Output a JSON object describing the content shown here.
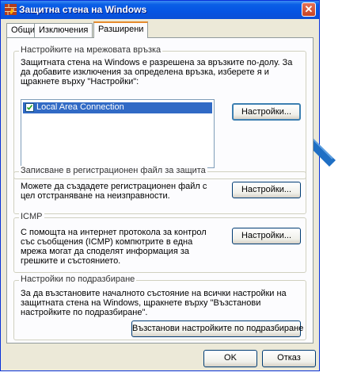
{
  "window": {
    "title": "Защитна стена на Windows",
    "close_glyph": "✕"
  },
  "tabs": [
    {
      "label": "Общи"
    },
    {
      "label": "Изключения"
    },
    {
      "label": "Разширени"
    }
  ],
  "active_tab": "Разширени",
  "network": {
    "legend": "Настройките на мрежовата връзка",
    "description": "Защитната стена на Windows е разрешена за връзките по-долу. За да добавите изключения за определена връзка, изберете я и щракнете върху \"Настройки\":",
    "connections": [
      {
        "label": "Local Area Connection",
        "checked": true,
        "selected": true
      }
    ],
    "settings_button": "Настройки..."
  },
  "logging": {
    "legend": "Записване в регистрационен файл за защита",
    "description": "Можете да създадете регистрационен файл с цел отстраняване на неизправности.",
    "settings_button": "Настройки..."
  },
  "icmp": {
    "legend": "ICMP",
    "description": "С помощта на интернет протокола за контрол със съобщения (ICMP) компютрите в една мрежа могат да споделят информация за грешките и състоянието.",
    "settings_button": "Настройки..."
  },
  "defaults": {
    "legend": "Настройки по подразбиране",
    "description": "За да възстановите началното състояние на всички настройки на защитната стена на Windows, щракнете върху \"Възстанови настройките по подразбиране\".",
    "restore_button": "Възстанови настройките по подразбиране"
  },
  "footer": {
    "ok_button": "OK",
    "cancel_button": "Отказ"
  },
  "colors": {
    "titlebar": "#0554e3",
    "selection": "#316ac5",
    "tab_highlight": "#e68b2c",
    "arrow": "#1f6fc4"
  }
}
